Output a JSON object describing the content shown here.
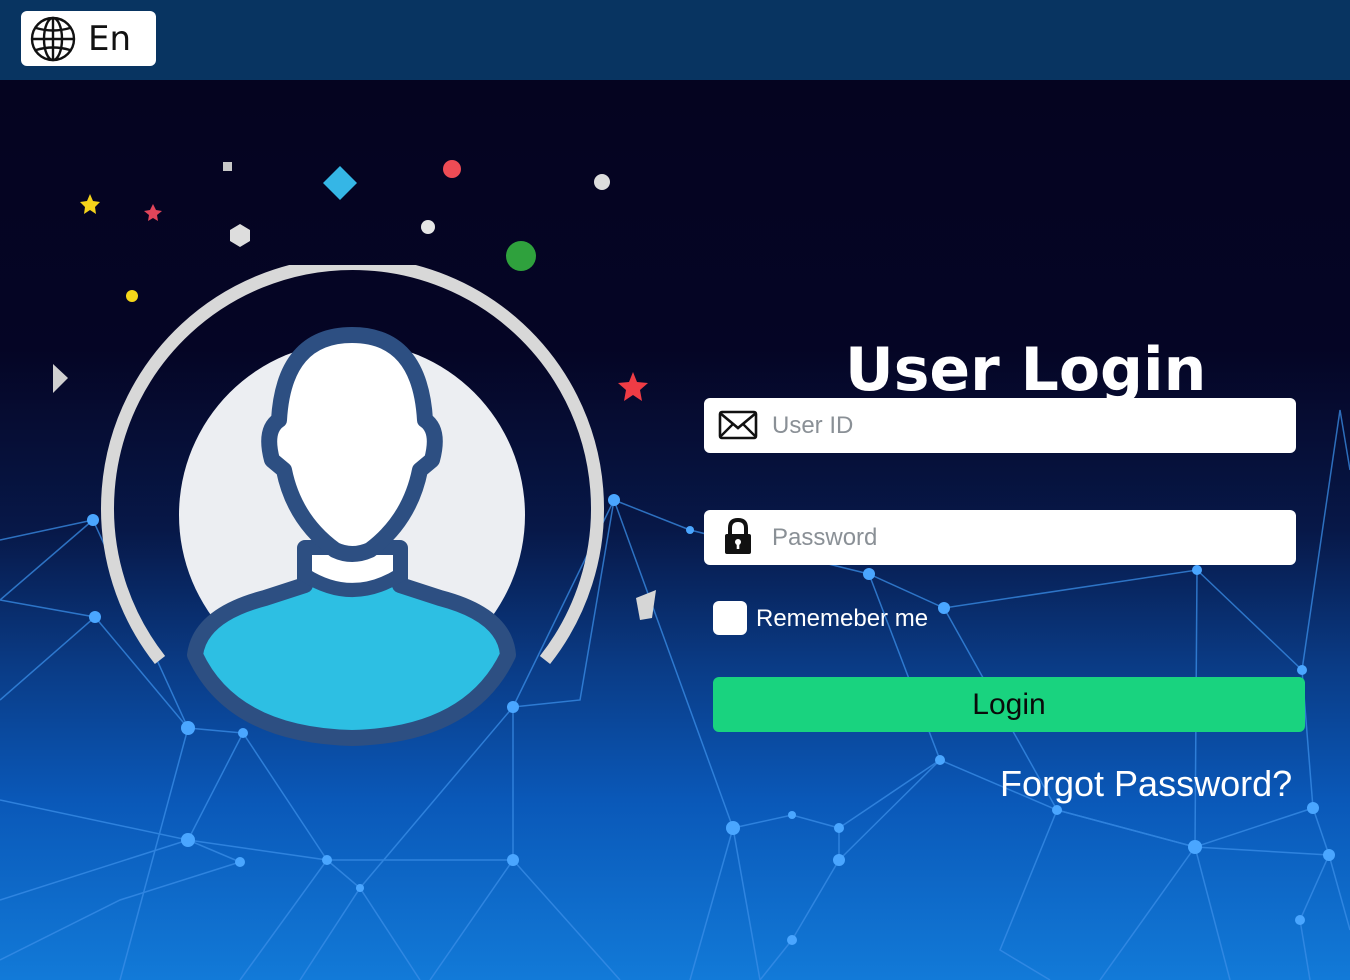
{
  "header": {
    "language_label": "En",
    "language_icon": "globe-icon"
  },
  "login": {
    "title": "User Login",
    "user_id": {
      "placeholder": "User ID",
      "value": "",
      "icon": "envelope-icon"
    },
    "password": {
      "placeholder": "Password",
      "value": "",
      "icon": "lock-icon"
    },
    "remember_label": "Rememeber me",
    "remember_checked": false,
    "login_button": "Login",
    "forgot_link": "Forgot Password?"
  },
  "illustration": {
    "icon": "user-avatar-icon"
  },
  "colors": {
    "header_bg": "#083461",
    "login_button": "#19d37f",
    "avatar_outline": "#2d4f82",
    "avatar_shirt": "#2dbfe3"
  }
}
